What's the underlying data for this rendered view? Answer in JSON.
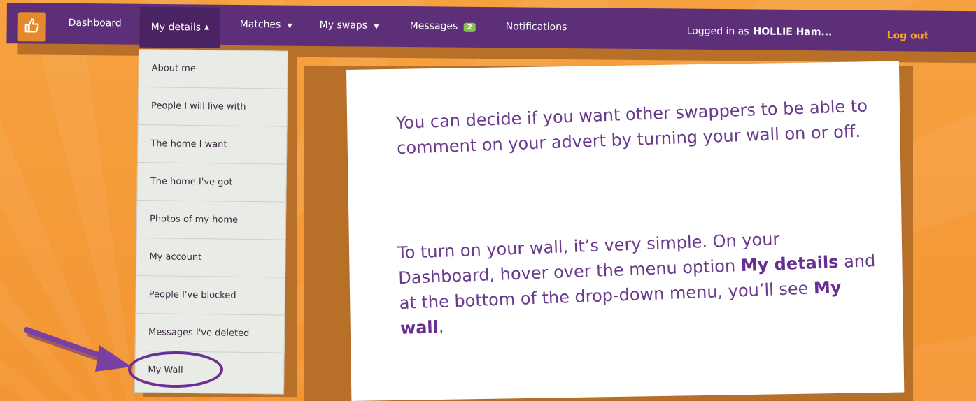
{
  "nav": {
    "home_icon": "thumbs-up-icon",
    "dashboard": "Dashboard",
    "my_details": "My details",
    "matches": "Matches",
    "my_swaps": "My swaps",
    "messages": "Messages",
    "messages_badge": "2",
    "notifications": "Notifications",
    "logged_in_label": "Logged in as",
    "user_name": "HOLLIE Ham...",
    "logout": "Log out"
  },
  "dropdown": {
    "items": [
      {
        "label": "About me"
      },
      {
        "label": "People I will live with"
      },
      {
        "label": "The home I want"
      },
      {
        "label": "The home I've got"
      },
      {
        "label": "Photos of my home"
      },
      {
        "label": "My account"
      },
      {
        "label": "People I've blocked"
      },
      {
        "label": "Messages I've deleted"
      },
      {
        "label": "My Wall"
      }
    ]
  },
  "card": {
    "para1": "You can decide if you want other swappers to be able to comment on your advert by turning your wall on or off.",
    "para2_a": "To turn on your wall, it’s very simple. On your Dashboard, hover over the menu option ",
    "para2_b": "My details",
    "para2_c": " and at the bottom of the drop-down menu, you’ll see ",
    "para2_d": "My wall",
    "para2_e": "."
  },
  "colors": {
    "background": "#f49a3c",
    "nav_bg": "#5c2f78",
    "accent_purple": "#6b2f95",
    "badge_green": "#8bc34a",
    "logout_orange": "#f5a623"
  }
}
